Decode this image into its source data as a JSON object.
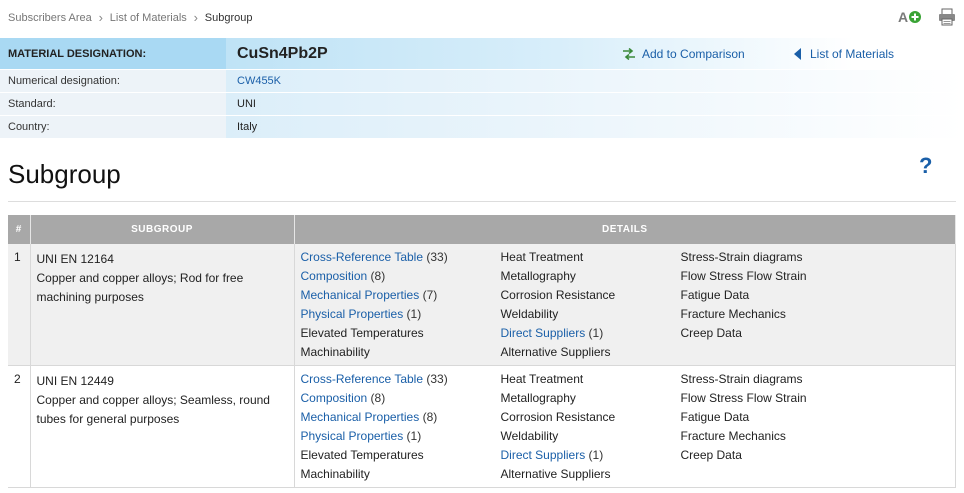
{
  "breadcrumb": {
    "items": [
      "Subscribers Area",
      "List of Materials",
      "Subgroup"
    ]
  },
  "material": {
    "designation_label": "MATERIAL DESIGNATION:",
    "designation_value": "CuSn4Pb2P",
    "add_comparison": "Add to Comparison",
    "list_materials": "List of Materials",
    "numerical_label": "Numerical designation:",
    "numerical_value": "CW455K",
    "standard_label": "Standard:",
    "standard_value": "UNI",
    "country_label": "Country:",
    "country_value": "Italy"
  },
  "page": {
    "title": "Subgroup",
    "help": "?"
  },
  "table": {
    "headers": [
      "#",
      "SUBGROUP",
      "DETAILS"
    ],
    "rows": [
      {
        "num": "1",
        "standard": "UNI EN 12164",
        "description": "Copper and copper alloys; Rod for free machining purposes",
        "col1": [
          {
            "label": "Cross-Reference Table",
            "count": "(33)"
          },
          {
            "label": "Composition",
            "count": "(8)"
          },
          {
            "label": "Mechanical Properties",
            "count": "(7)"
          },
          {
            "label": "Physical Properties",
            "count": "(1)"
          },
          {
            "label": "Elevated Temperatures"
          },
          {
            "label": "Machinability"
          }
        ],
        "col2": [
          {
            "label": "Heat Treatment"
          },
          {
            "label": "Metallography"
          },
          {
            "label": "Corrosion Resistance"
          },
          {
            "label": "Weldability"
          },
          {
            "label": "Direct Suppliers",
            "count": "(1)"
          },
          {
            "label": "Alternative Suppliers"
          }
        ],
        "col3": [
          {
            "label": "Stress-Strain diagrams"
          },
          {
            "label": "Flow Stress Flow Strain"
          },
          {
            "label": "Fatigue Data"
          },
          {
            "label": "Fracture Mechanics"
          },
          {
            "label": "Creep Data"
          }
        ]
      },
      {
        "num": "2",
        "standard": "UNI EN 12449",
        "description": "Copper and copper alloys; Seamless, round tubes for general purposes",
        "col1": [
          {
            "label": "Cross-Reference Table",
            "count": "(33)"
          },
          {
            "label": "Composition",
            "count": "(8)"
          },
          {
            "label": "Mechanical Properties",
            "count": "(8)"
          },
          {
            "label": "Physical Properties",
            "count": "(1)"
          },
          {
            "label": "Elevated Temperatures"
          },
          {
            "label": "Machinability"
          }
        ],
        "col2": [
          {
            "label": "Heat Treatment"
          },
          {
            "label": "Metallography"
          },
          {
            "label": "Corrosion Resistance"
          },
          {
            "label": "Weldability"
          },
          {
            "label": "Direct Suppliers",
            "count": "(1)"
          },
          {
            "label": "Alternative Suppliers"
          }
        ],
        "col3": [
          {
            "label": "Stress-Strain diagrams"
          },
          {
            "label": "Flow Stress Flow Strain"
          },
          {
            "label": "Fatigue Data"
          },
          {
            "label": "Fracture Mechanics"
          },
          {
            "label": "Creep Data"
          }
        ]
      }
    ]
  },
  "icons": {
    "font_size": "font-size-icon",
    "print": "printer-icon",
    "compare": "compare-arrows-icon",
    "back": "back-arrow-icon"
  },
  "colors": {
    "link": "#1a5fa8",
    "header_bg": "#a8a8a8",
    "designation_bg": "#a9d9f3"
  }
}
